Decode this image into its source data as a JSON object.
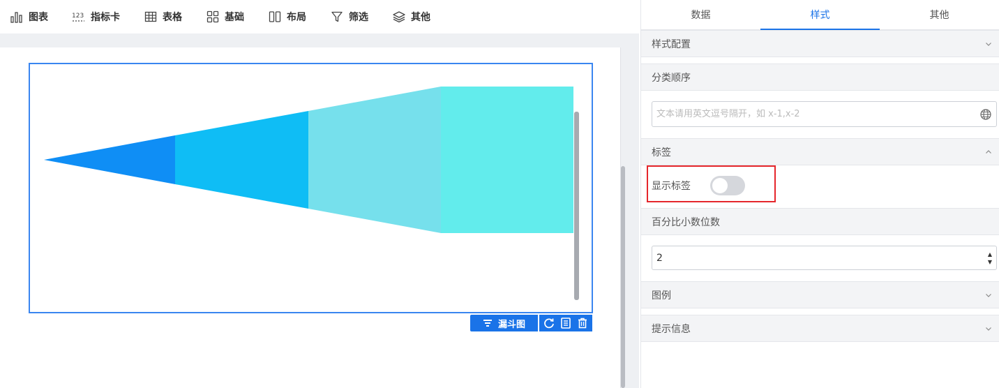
{
  "toolbar": {
    "items": [
      {
        "label": "图表",
        "icon": "bar-chart-icon"
      },
      {
        "label": "指标卡",
        "icon": "number-card-icon",
        "icon_text": "123"
      },
      {
        "label": "表格",
        "icon": "table-grid-icon"
      },
      {
        "label": "基础",
        "icon": "basic-blocks-icon"
      },
      {
        "label": "布局",
        "icon": "layout-columns-icon"
      },
      {
        "label": "筛选",
        "icon": "filter-funnel-icon"
      },
      {
        "label": "其他",
        "icon": "layers-icon"
      }
    ]
  },
  "chart_widget": {
    "type_label": "漏斗图",
    "type_icon": "funnel-list-icon",
    "tools": [
      "refresh-icon",
      "data-sheet-icon",
      "delete-trash-icon"
    ],
    "funnel_colors": [
      "#0f8ef5",
      "#0fbdf5",
      "#76e0ec",
      "#62ecec"
    ]
  },
  "chart_data": {
    "type": "funnel",
    "orientation": "horizontal",
    "segments": 4,
    "relative_widths": [
      0.33,
      0.67,
      0.84,
      1.0
    ],
    "labels_shown": false
  },
  "panel": {
    "tabs": [
      {
        "label": "数据",
        "active": false
      },
      {
        "label": "样式",
        "active": true
      },
      {
        "label": "其他",
        "active": false
      }
    ],
    "sections": {
      "style_config": {
        "label": "样式配置",
        "expanded": false
      },
      "category_order": {
        "label": "分类顺序",
        "placeholder": "文本请用英文逗号隔开，如 x-1,x-2",
        "value": ""
      },
      "labels": {
        "label": "标签",
        "expanded": true,
        "show_label": "显示标签",
        "show_label_on": false
      },
      "percent_decimals": {
        "label": "百分比小数位数",
        "value": "2"
      },
      "legend": {
        "label": "图例",
        "expanded": false
      },
      "tooltip": {
        "label": "提示信息",
        "expanded": false
      }
    }
  }
}
